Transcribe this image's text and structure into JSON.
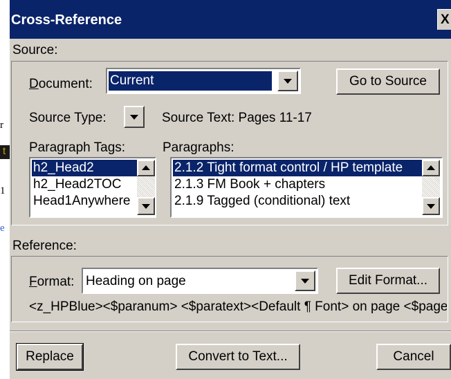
{
  "background_fragments": [
    "r",
    "t",
    "1",
    "e"
  ],
  "dialog": {
    "title": "Cross-Reference",
    "close_glyph": "X",
    "source_label": "Source:",
    "reference_label": "Reference:"
  },
  "source": {
    "document_label": "Document:",
    "document_value": "Current",
    "go_to_source_label": "Go to Source",
    "source_type_label": "Source Type:",
    "source_text": "Source Text: Pages 11-17",
    "paragraph_tags_label": "Paragraph Tags:",
    "paragraph_tags": [
      "h2_Head2",
      "h2_Head2TOC",
      "Head1Anywhere"
    ],
    "paragraph_tags_selected": 0,
    "paragraphs_label": "Paragraphs:",
    "paragraphs": [
      "2.1.2 Tight format control / HP template",
      "2.1.3 FM Book + chapters",
      "2.1.9 Tagged (conditional) text"
    ],
    "paragraphs_selected": 0
  },
  "reference": {
    "format_label": "Format:",
    "format_value": "Heading on page",
    "edit_format_label": "Edit Format...",
    "format_definition": "<z_HPBlue><$paranum> <$paratext><Default ¶ Font> on page <$pagenum>"
  },
  "buttons": {
    "replace": "Replace",
    "convert": "Convert to Text...",
    "cancel": "Cancel"
  },
  "icons": [
    "close-icon",
    "dropdown-arrow-icon",
    "scroll-up-arrow-icon",
    "scroll-down-arrow-icon"
  ],
  "colors": {
    "titlebar": "#0a246a",
    "dialog_face": "#d4d0c8",
    "selection": "#0a246a"
  }
}
